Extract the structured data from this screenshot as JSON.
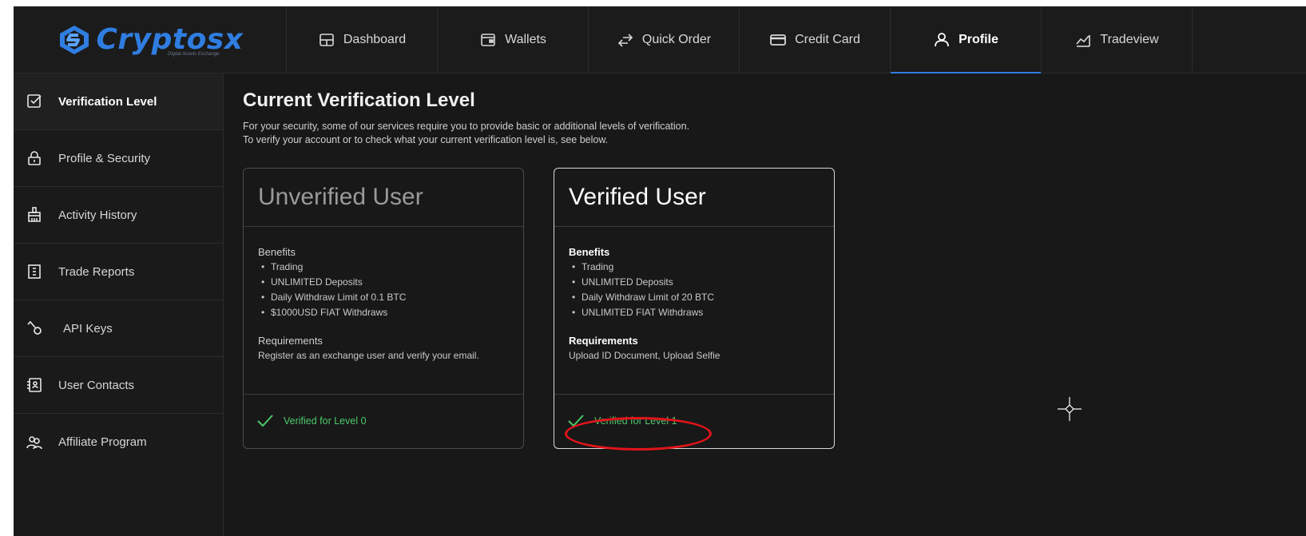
{
  "brand": {
    "name": "Cryptosx",
    "tagline": "Digital Assets Exchange"
  },
  "topnav": {
    "tabs": [
      {
        "label": "Dashboard",
        "icon": "dashboard-icon"
      },
      {
        "label": "Wallets",
        "icon": "wallet-icon"
      },
      {
        "label": "Quick Order",
        "icon": "swap-arrows-icon"
      },
      {
        "label": "Credit Card",
        "icon": "credit-card-icon"
      },
      {
        "label": "Profile",
        "icon": "user-icon",
        "active": true
      },
      {
        "label": "Tradeview",
        "icon": "chart-line-icon"
      }
    ]
  },
  "sidebar": {
    "items": [
      {
        "label": "Verification Level",
        "icon": "checkbox-icon",
        "active": true
      },
      {
        "label": "Profile & Security",
        "icon": "lock-icon"
      },
      {
        "label": "Activity History",
        "icon": "broom-icon"
      },
      {
        "label": "Trade Reports",
        "icon": "report-list-icon"
      },
      {
        "label": "API Keys",
        "icon": "key-icon"
      },
      {
        "label": "User Contacts",
        "icon": "contacts-icon"
      },
      {
        "label": "Affiliate Program",
        "icon": "affiliate-users-icon"
      }
    ]
  },
  "main": {
    "title": "Current Verification Level",
    "desc_line1": "For your security, some of our services require you to provide basic or additional levels of verification.",
    "desc_line2": "To verify your account or to check what your current verification level is, see below.",
    "cards": [
      {
        "title": "Unverified User",
        "benefits_title": "Benefits",
        "benefits": [
          "Trading",
          "UNLIMITED Deposits",
          "Daily Withdraw Limit of 0.1 BTC",
          "$1000USD FIAT Withdraws"
        ],
        "requirements_title": "Requirements",
        "requirements": "Register as an exchange user and verify your email.",
        "status": "Verified for Level 0"
      },
      {
        "title": "Verified User",
        "benefits_title": "Benefits",
        "benefits": [
          "Trading",
          "UNLIMITED Deposits",
          "Daily Withdraw Limit of 20 BTC",
          "UNLIMITED FIAT Withdraws"
        ],
        "requirements_title": "Requirements",
        "requirements": "Upload ID Document, Upload Selfie",
        "status": "Verified for Level 1"
      }
    ]
  },
  "colors": {
    "accent": "#2f7de1",
    "success": "#4cc96a",
    "annotation": "#e3141a",
    "background": "#181818"
  }
}
